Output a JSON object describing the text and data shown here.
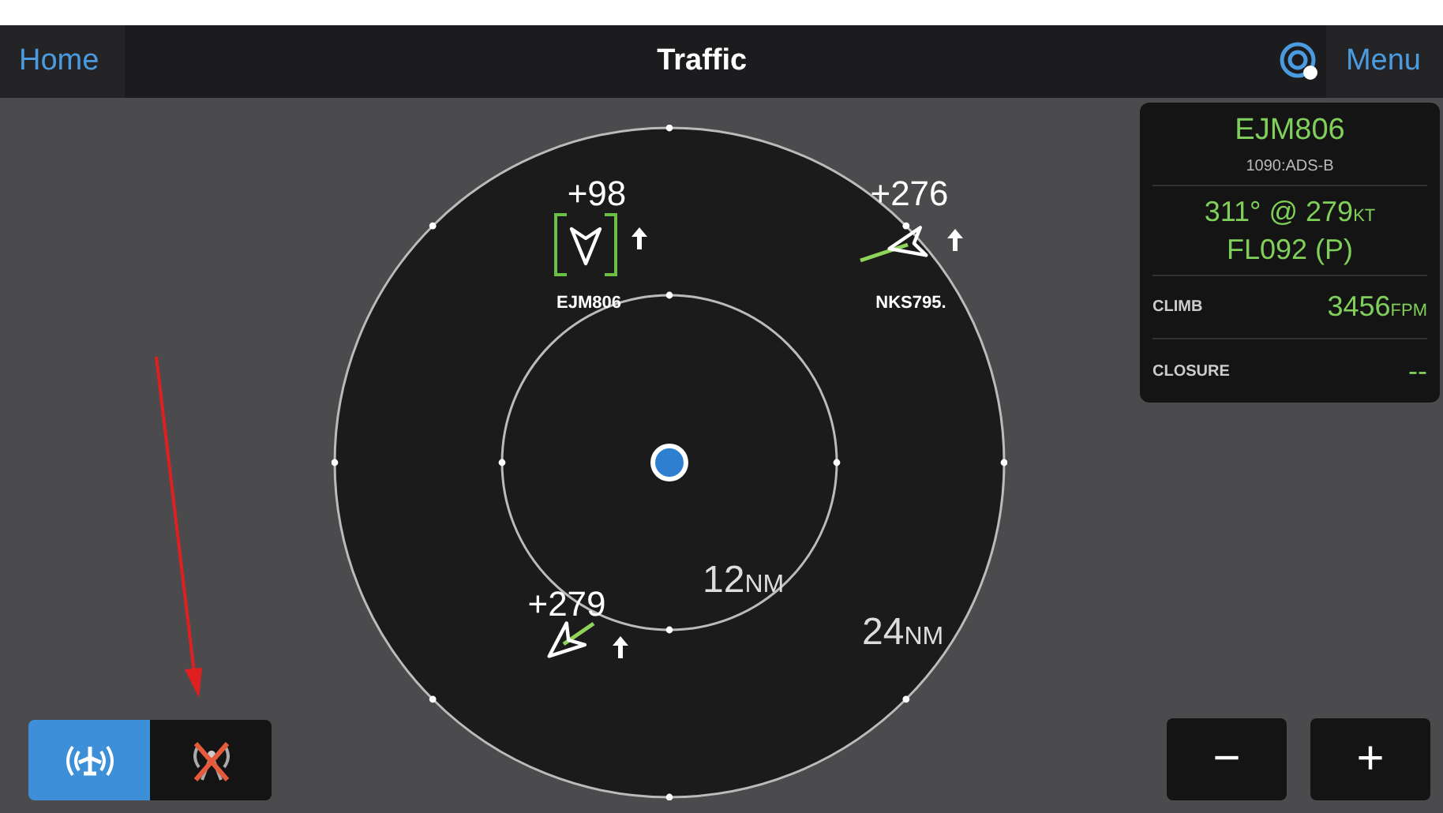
{
  "header": {
    "home": "Home",
    "title": "Traffic",
    "menu": "Menu"
  },
  "targets": [
    {
      "altitude": "+98",
      "callsign": "EJM806",
      "selected": true,
      "climbing": true
    },
    {
      "altitude": "+276",
      "callsign": "NKS795.",
      "selected": false,
      "climbing": true
    },
    {
      "altitude": "+279",
      "selected": false,
      "climbing": true
    }
  ],
  "range_labels": [
    {
      "value": "12",
      "unit": "NM"
    },
    {
      "value": "24",
      "unit": "NM"
    }
  ],
  "info_panel": {
    "callsign": "EJM806",
    "source": "1090:ADS-B",
    "track": {
      "text": "311° @ 279",
      "unit": "KT"
    },
    "altitude": "FL092 (P)",
    "rows": [
      {
        "label": "CLIMB",
        "value": "3456",
        "unit": "FPM"
      },
      {
        "label": "CLOSURE",
        "value": "--"
      }
    ]
  },
  "mode_toggle": [
    {
      "kind": "traffic",
      "selected": true
    },
    {
      "kind": "off",
      "selected": false
    }
  ],
  "zoom_buttons": [
    "−",
    "+"
  ]
}
